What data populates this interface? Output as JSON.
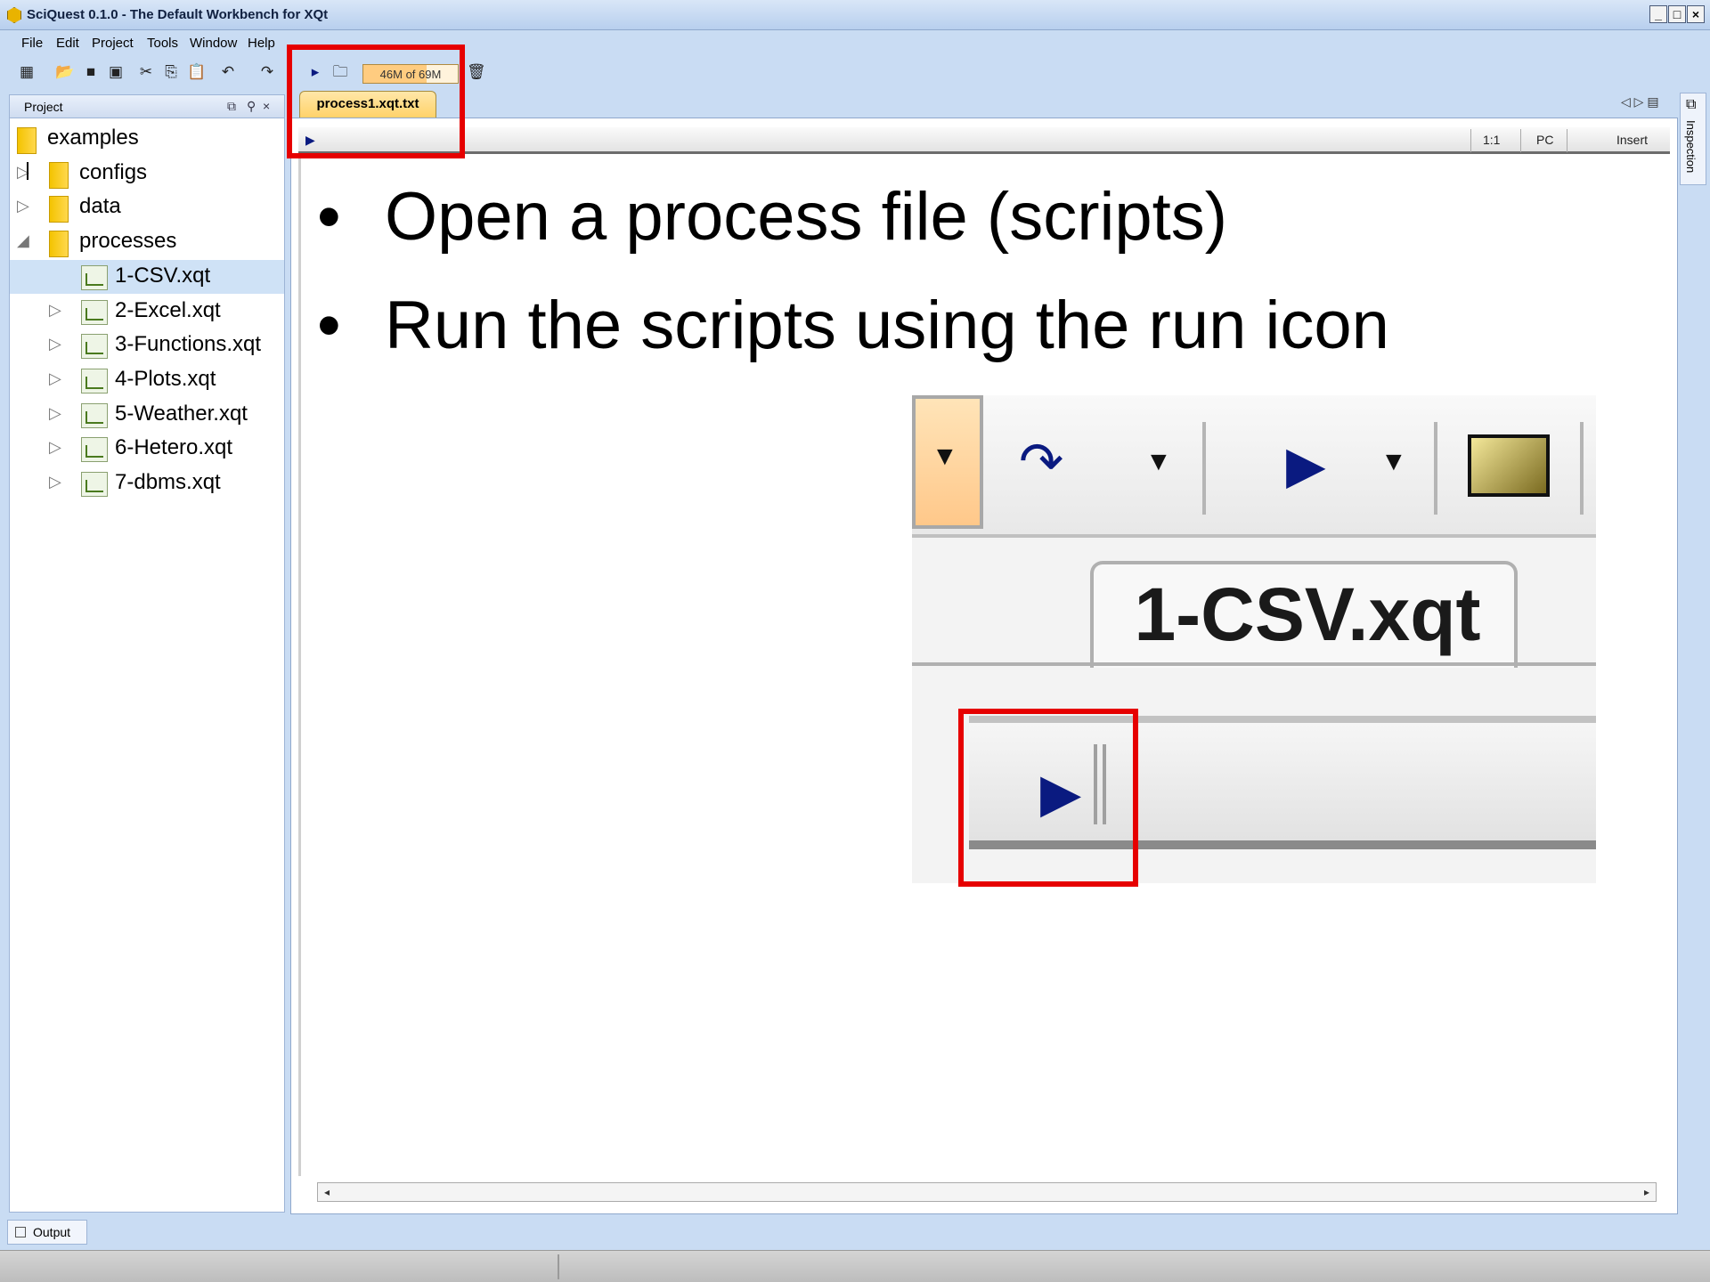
{
  "window": {
    "title": "SciQuest 0.1.0 - The Default Workbench for XQt"
  },
  "menu": [
    "File",
    "Edit",
    "Project",
    "Tools",
    "Window",
    "Help"
  ],
  "toolbar": {
    "memory_text": "46M of 69M",
    "memory_used_fraction": 0.667
  },
  "project": {
    "title": "Project",
    "tree": [
      {
        "label": "examples",
        "type": "folder",
        "level": 0
      },
      {
        "label": "configs",
        "type": "folder",
        "level": 1
      },
      {
        "label": "data",
        "type": "folder",
        "level": 1
      },
      {
        "label": "processes",
        "type": "folder",
        "level": 1,
        "expanded": true
      },
      {
        "label": "1-CSV.xqt",
        "type": "file",
        "level": 2,
        "selected": true
      },
      {
        "label": "2-Excel.xqt",
        "type": "file",
        "level": 2
      },
      {
        "label": "3-Functions.xqt",
        "type": "file",
        "level": 2
      },
      {
        "label": "4-Plots.xqt",
        "type": "file",
        "level": 2
      },
      {
        "label": "5-Weather.xqt",
        "type": "file",
        "level": 2
      },
      {
        "label": "6-Hetero.xqt",
        "type": "file",
        "level": 2
      },
      {
        "label": "7-dbms.xqt",
        "type": "file",
        "level": 2
      }
    ]
  },
  "editor": {
    "tab": "process1.xqt.txt",
    "status": {
      "position": "1:1",
      "line_ending": "PC",
      "mode": "Insert"
    }
  },
  "slide": {
    "bullets": [
      "Open a process file (scripts)",
      "Run the scripts using the run icon"
    ]
  },
  "inset": {
    "tab_label": "1-CSV.xqt"
  },
  "side": {
    "inspection": "Inspection"
  },
  "bottom": {
    "output_tab": "Output"
  },
  "colors": {
    "highlight": "#e60000",
    "memory_fill": "#ffcc80",
    "tab_active": "#ffd26a"
  }
}
